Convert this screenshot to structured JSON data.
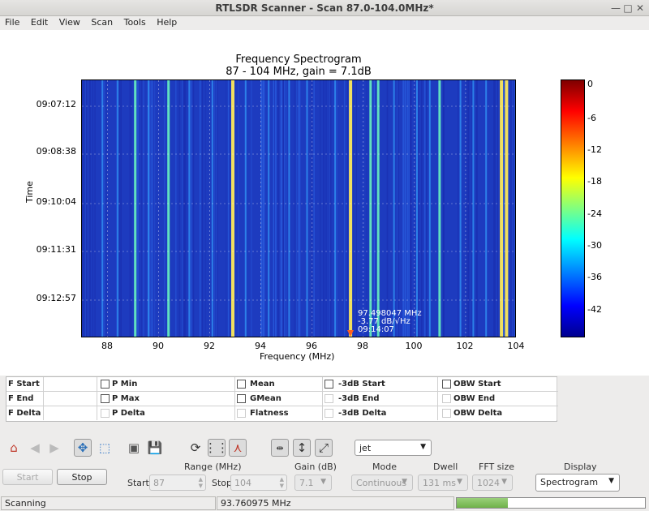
{
  "window": {
    "title": "RTLSDR Scanner - Scan 87.0-104.0MHz*"
  },
  "menu": [
    "File",
    "Edit",
    "View",
    "Scan",
    "Tools",
    "Help"
  ],
  "chart": {
    "title": "Frequency Spectrogram",
    "subtitle": "87 - 104 MHz, gain = 7.1dB",
    "xlabel": "Frequency (MHz)",
    "ylabel": "Time",
    "yticks": [
      "09:07:12",
      "09:08:38",
      "09:10:04",
      "09:11:31",
      "09:12:57"
    ],
    "xticks": [
      "88",
      "90",
      "92",
      "94",
      "96",
      "98",
      "100",
      "102",
      "104"
    ],
    "colorbar_ticks": [
      "0",
      "-6",
      "-12",
      "-18",
      "-24",
      "-30",
      "-36",
      "-42"
    ],
    "annotation": {
      "freq": "97.498047 MHz",
      "level": "-3.77 dB/√Hz",
      "time": "09:14:07"
    }
  },
  "chart_data": {
    "type": "heatmap",
    "title": "Frequency Spectrogram",
    "subtitle": "87 - 104 MHz, gain = 7.1dB",
    "xlabel": "Frequency (MHz)",
    "ylabel": "Time",
    "xlim": [
      87,
      104
    ],
    "colorbar_range": [
      -46,
      1
    ],
    "colormap": "jet",
    "grid": true,
    "time_ticks": [
      "09:07:12",
      "09:08:38",
      "09:10:04",
      "09:11:31",
      "09:12:57"
    ],
    "strong_signals_mhz": [
      89.1,
      90.4,
      92.9,
      97.5,
      98.3,
      98.6,
      101.0,
      103.4,
      103.6
    ],
    "annotation": {
      "frequency_mhz": 97.498047,
      "level_db": -3.77,
      "time": "09:14:07"
    }
  },
  "measure": {
    "rows": [
      {
        "f": "F Start",
        "p": "P Min",
        "m": "Mean",
        "db": "-3dB Start",
        "obw": "OBW Start"
      },
      {
        "f": "F End",
        "p": "P Max",
        "m": "GMean",
        "db": "-3dB End",
        "obw": "OBW End"
      },
      {
        "f": "F Delta",
        "p": "P Delta",
        "m": "Flatness",
        "db": "-3dB Delta",
        "obw": "OBW Delta"
      }
    ]
  },
  "toolbar": {
    "colormap": "jet"
  },
  "controls": {
    "start_button": "Start",
    "stop_button": "Stop",
    "range_label": "Range (MHz)",
    "start_label": "Start",
    "start_value": "87",
    "stop_label": "Stop",
    "stop_value": "104",
    "gain_label": "Gain (dB)",
    "gain_value": "7.1",
    "mode_label": "Mode",
    "mode_value": "Continuous",
    "dwell_label": "Dwell",
    "dwell_value": "131 ms",
    "fft_label": "FFT size",
    "fft_value": "1024",
    "display_label": "Display",
    "display_value": "Spectrogram"
  },
  "status": {
    "state": "Scanning",
    "frequency": "93.760975 MHz",
    "progress": 0.27
  },
  "colors": {
    "background": "#1d3bbf",
    "signal_strong": "#f0e060",
    "signal_mid": "#60e0c0"
  }
}
